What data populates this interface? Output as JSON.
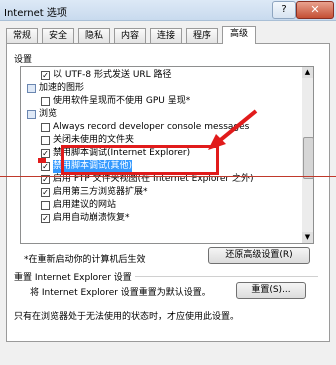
{
  "window": {
    "title": "Internet 选项",
    "help_label": "?",
    "close_label": "✕"
  },
  "tabs": [
    {
      "label": "常规",
      "active": false
    },
    {
      "label": "安全",
      "active": false
    },
    {
      "label": "隐私",
      "active": false
    },
    {
      "label": "内容",
      "active": false
    },
    {
      "label": "连接",
      "active": false
    },
    {
      "label": "程序",
      "active": false
    },
    {
      "label": "高级",
      "active": true
    }
  ],
  "settings": {
    "group_label": "设置",
    "items": [
      {
        "label": "以 UTF-8 形式发送 URL 路径",
        "checked": true,
        "indent": 2
      },
      {
        "label": "加速的图形",
        "checked": null,
        "indent": 1
      },
      {
        "label": "使用软件呈现而不使用 GPU 呈现*",
        "checked": false,
        "indent": 2
      },
      {
        "label": "浏览",
        "checked": null,
        "indent": 1
      },
      {
        "label": "Always record developer console messages",
        "checked": false,
        "indent": 2
      },
      {
        "label": "关闭未使用的文件夹",
        "checked": false,
        "indent": 2
      },
      {
        "label": "禁用脚本调试(Internet Explorer)",
        "checked": true,
        "indent": 2
      },
      {
        "label": "禁用脚本调试(其他)",
        "checked": true,
        "indent": 2,
        "selected": true
      },
      {
        "label": "启用 FTP 文件夹视图(在 Internet Explorer 之外)",
        "checked": true,
        "indent": 2
      },
      {
        "label": "启用第三方浏览器扩展*",
        "checked": true,
        "indent": 2
      },
      {
        "label": "启用建议的网站",
        "checked": false,
        "indent": 2
      },
      {
        "label": "启用自动崩溃恢复*",
        "checked": true,
        "indent": 2
      }
    ],
    "restart_note": "*在重新启动你的计算机后生效",
    "restore_button": "还原高级设置(R)"
  },
  "reset": {
    "group_label": "重置 Internet Explorer 设置",
    "description": "将 Internet Explorer 设置重置为默认设置。",
    "button": "重置(S)...",
    "note": "只有在浏览器处于无法使用的状态时，才应使用此设置。"
  },
  "colors": {
    "selection": "#3399ff",
    "annotation": "#e11b1b"
  }
}
